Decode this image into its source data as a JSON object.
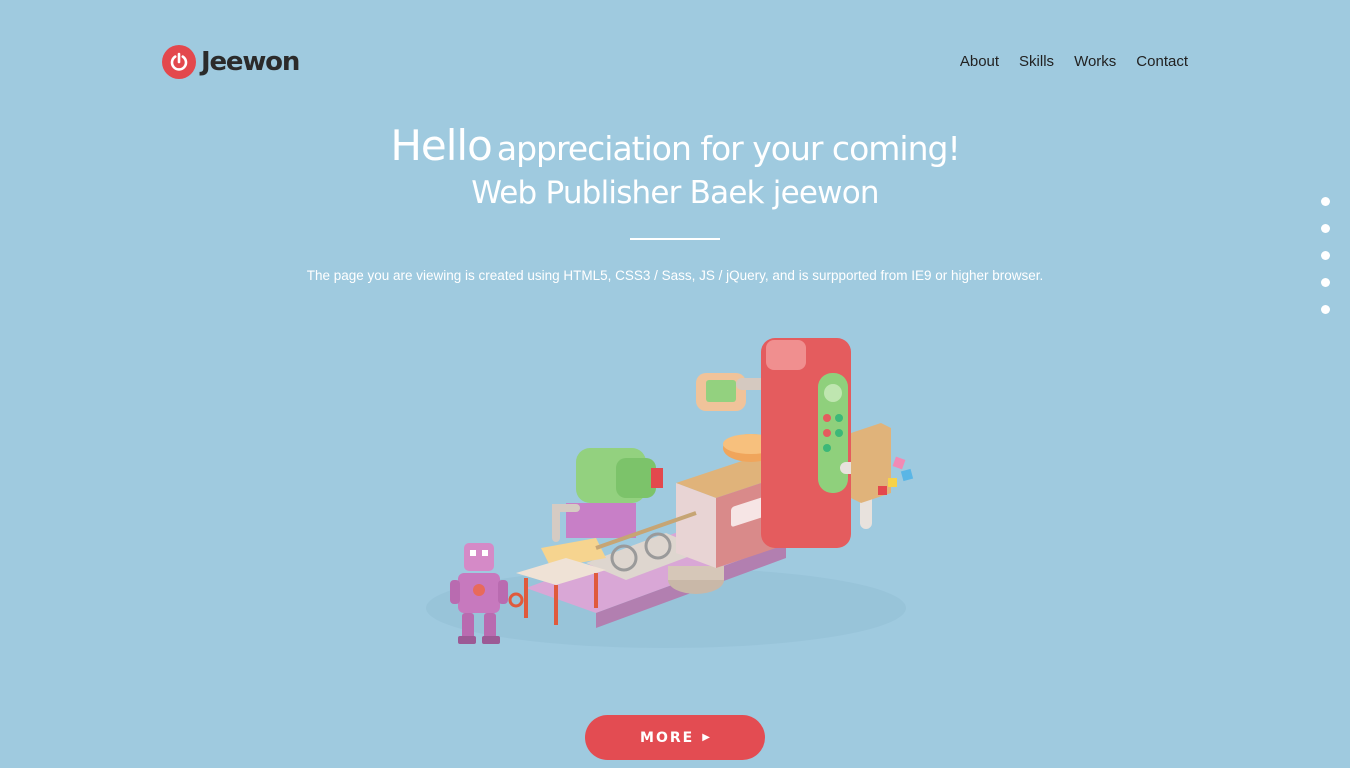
{
  "brand": {
    "name": "Jeewon",
    "icon": "power-icon",
    "accent_color": "#e3484d"
  },
  "nav": {
    "items": [
      {
        "label": "About"
      },
      {
        "label": "Skills"
      },
      {
        "label": "Works"
      },
      {
        "label": "Contact"
      }
    ]
  },
  "hero": {
    "hello": "Hello",
    "greeting": "appreciation for your coming!",
    "subtitle": "Web Publisher Baek jeewon",
    "description": "The page you are viewing is created using HTML5, CSS3 / Sass, JS / jQuery, and is surpported from IE9 or higher browser."
  },
  "illustration": {
    "icon": "factory-robot-illustration"
  },
  "cta": {
    "label": "MORE",
    "icon": "caret-right-icon",
    "color": "#e34c52"
  },
  "section_dots": {
    "count": 5
  },
  "colors": {
    "background": "#9fcadf",
    "text": "#ffffff",
    "nav_text": "#222222"
  }
}
